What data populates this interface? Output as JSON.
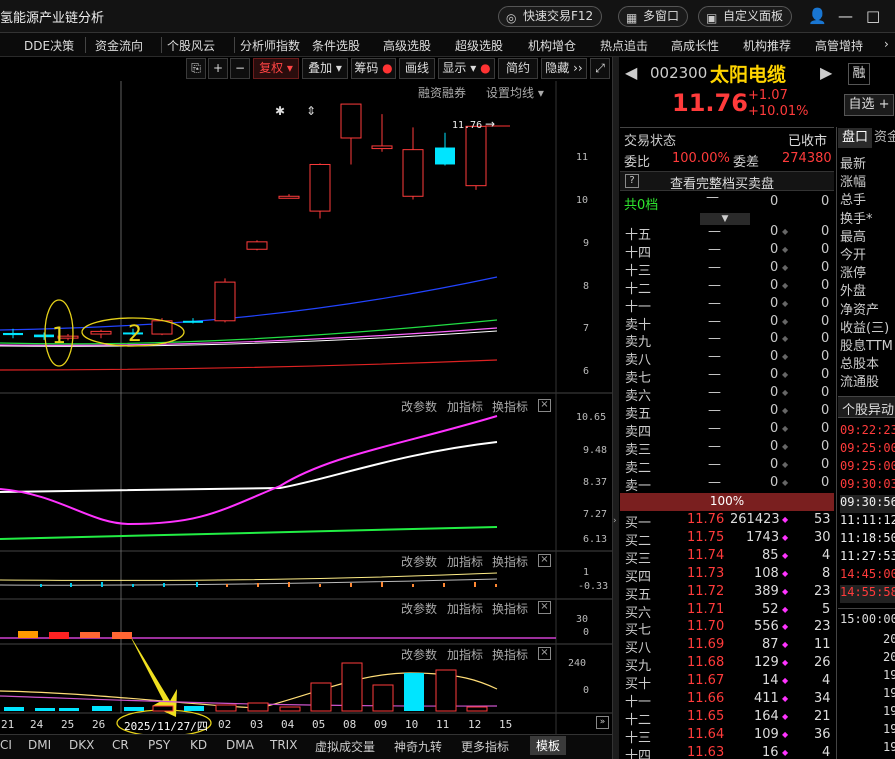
{
  "titlebar": {
    "app_title": "氢能源产业链分析",
    "quick_trade": "快速交易F12",
    "multi_window": "多窗口",
    "custom_panel": "自定义面板"
  },
  "menu": [
    "DDE决策",
    "资金流向",
    "个股风云",
    "分析师指数",
    "条件选股",
    "高级选股",
    "超级选股",
    "机构增仓",
    "热点追击",
    "高成长性",
    "机构推荐",
    "高管增持"
  ],
  "toolbar": {
    "restore": "复权",
    "overlay": "叠加",
    "chips": "筹码",
    "draw": "画线",
    "display": "显示",
    "simple": "简约",
    "hide": "隐藏"
  },
  "chart_controls": {
    "margin": "融资融券",
    "set_ma": "设置均线",
    "modify": "改参数",
    "add": "加指标",
    "switch": "换指标"
  },
  "price_tag": "11.76",
  "chart_data": [
    {
      "type": "candlestick",
      "categories": [
        "21",
        "24",
        "25",
        "26",
        "11/27",
        "28",
        "02",
        "03",
        "04",
        "05",
        "08",
        "09",
        "10",
        "11",
        "12",
        "15"
      ],
      "ohlc": [
        [
          6.82,
          6.9,
          6.72,
          6.78
        ],
        [
          6.79,
          6.83,
          6.69,
          6.74
        ],
        [
          6.73,
          6.8,
          6.68,
          6.76
        ],
        [
          6.8,
          6.88,
          6.72,
          6.85
        ],
        [
          6.83,
          6.9,
          6.78,
          6.81
        ],
        [
          6.8,
          7.1,
          6.78,
          7.05
        ],
        [
          7.05,
          7.1,
          7.0,
          7.03
        ],
        [
          7.05,
          7.85,
          7.02,
          7.78
        ],
        [
          8.4,
          8.57,
          8.38,
          8.54
        ],
        [
          9.38,
          9.44,
          9.36,
          9.4
        ],
        [
          9.12,
          10.02,
          8.98,
          10.0
        ],
        [
          10.5,
          11.0,
          10.0,
          11.14
        ],
        [
          10.3,
          10.95,
          10.24,
          10.35
        ],
        [
          9.4,
          10.7,
          9.34,
          10.28
        ],
        [
          10.32,
          10.6,
          9.98,
          10.0
        ],
        [
          9.6,
          10.73,
          9.52,
          10.72
        ]
      ],
      "yticks": [
        11.0,
        10.0,
        9.0,
        8.0,
        7.0,
        6.0
      ],
      "ylim": [
        5.7,
        11.5
      ],
      "annotations": [
        "1",
        "2"
      ]
    },
    {
      "type": "line",
      "yticks": [
        10.65,
        9.48,
        8.37,
        7.27,
        6.13
      ]
    },
    {
      "type": "line",
      "yticks": [
        1.0,
        -0.33
      ]
    },
    {
      "type": "bar",
      "yticks": [
        30.0,
        0.0
      ]
    },
    {
      "type": "bar",
      "yticks": [
        240.0,
        0.0
      ]
    }
  ],
  "dates": [
    "21",
    "24",
    "25",
    "26",
    "2025/11/27/四",
    "02",
    "03",
    "04",
    "05",
    "08",
    "09",
    "10",
    "11",
    "12",
    "15"
  ],
  "indicator_tabs": [
    "CI",
    "DMI",
    "DKX",
    "CR",
    "PSY",
    "KD",
    "DMA",
    "TRIX",
    "虚拟成交量",
    "神奇九转",
    "更多指标",
    "模板"
  ],
  "stock": {
    "code": "002300",
    "name": "太阳电缆",
    "rong": "融",
    "price": "11.76",
    "change": "+1.07",
    "change_pct": "+10.01%",
    "add_fav": "自选"
  },
  "status": {
    "trade_state_label": "交易状态",
    "trade_state": "已收市",
    "ratio_label": "委比",
    "ratio": "100.00%",
    "diff_label": "委差",
    "diff": "274380",
    "full_book": "查看完整档买卖盘",
    "total_label": "共0档"
  },
  "sell_levels": [
    "十五",
    "十四",
    "十三",
    "十二",
    "十一",
    "卖十",
    "卖九",
    "卖八",
    "卖七",
    "卖六",
    "卖五",
    "卖四",
    "卖三",
    "卖二",
    "卖一"
  ],
  "buy_pct": "100%",
  "buy_levels": [
    {
      "level": "买一",
      "price": "11.76",
      "vol": "261423",
      "n": "53"
    },
    {
      "level": "买二",
      "price": "11.75",
      "vol": "1743",
      "n": "30"
    },
    {
      "level": "买三",
      "price": "11.74",
      "vol": "85",
      "n": "4"
    },
    {
      "level": "买四",
      "price": "11.73",
      "vol": "108",
      "n": "8"
    },
    {
      "level": "买五",
      "price": "11.72",
      "vol": "389",
      "n": "23"
    },
    {
      "level": "买六",
      "price": "11.71",
      "vol": "52",
      "n": "5"
    },
    {
      "level": "买七",
      "price": "11.70",
      "vol": "556",
      "n": "23"
    },
    {
      "level": "买八",
      "price": "11.69",
      "vol": "87",
      "n": "11"
    },
    {
      "level": "买九",
      "price": "11.68",
      "vol": "129",
      "n": "26"
    },
    {
      "level": "买十",
      "price": "11.67",
      "vol": "14",
      "n": "4"
    },
    {
      "level": "十一",
      "price": "11.66",
      "vol": "411",
      "n": "34"
    },
    {
      "level": "十二",
      "price": "11.65",
      "vol": "164",
      "n": "21"
    },
    {
      "level": "十三",
      "price": "11.64",
      "vol": "109",
      "n": "36"
    },
    {
      "level": "十四",
      "price": "11.63",
      "vol": "16",
      "n": "4"
    }
  ],
  "right_tabs": {
    "pankou": "盘口",
    "zijin": "资金"
  },
  "stats_labels": [
    "最新",
    "涨幅",
    "总手",
    "换手*",
    "最高",
    "今开",
    "涨停",
    "外盘",
    "净资产",
    "收益(三)",
    "股息TTM",
    "总股本",
    "流通股"
  ],
  "anomaly_title": "个股异动",
  "anomaly_times": [
    "09:22:23",
    "09:25:00",
    "09:25:00",
    "09:30:03",
    "09:30:56",
    "11:11:12",
    "11:18:50",
    "11:27:53",
    "14:45:00",
    "14:55:58"
  ],
  "ticks_time": "15:00:00",
  "ticks_vals": [
    "20",
    "20",
    "19",
    "19",
    "19",
    "19",
    "19"
  ],
  "colors": {
    "up": "#ff3b3b",
    "down": "#00e5ff",
    "accent": "#ffd400",
    "magenta": "#ff33ff"
  }
}
